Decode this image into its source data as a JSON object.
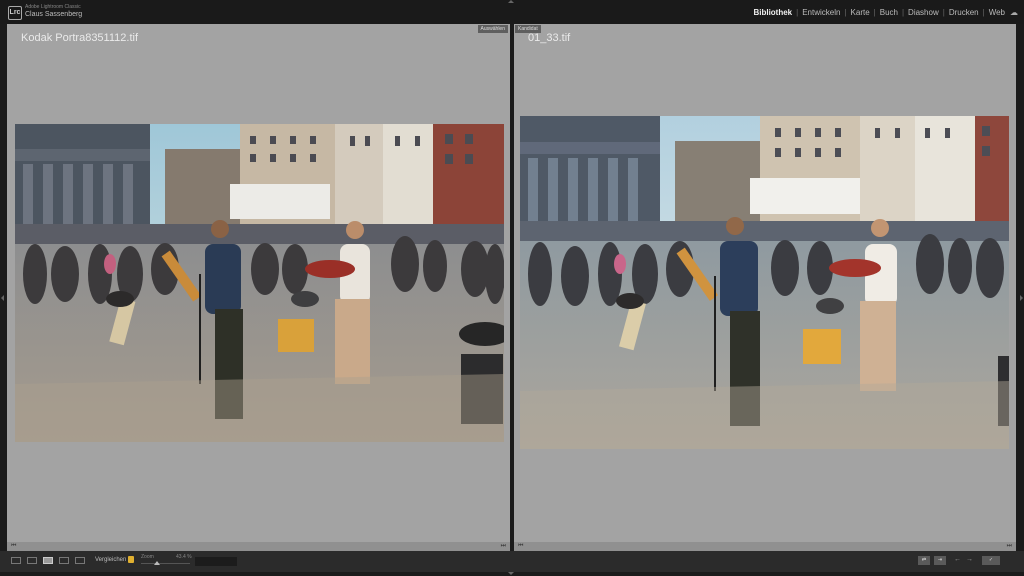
{
  "app": {
    "name": "Adobe Lightroom Classic",
    "user": "Claus Sassenberg",
    "logo_text": "Lrc"
  },
  "modules": [
    {
      "label": "Bibliothek",
      "active": true
    },
    {
      "label": "Entwickeln",
      "active": false
    },
    {
      "label": "Karte",
      "active": false
    },
    {
      "label": "Buch",
      "active": false
    },
    {
      "label": "Diashow",
      "active": false
    },
    {
      "label": "Drucken",
      "active": false
    },
    {
      "label": "Web",
      "active": false
    }
  ],
  "compare": {
    "select": {
      "filename": "Kodak Portra8351112.tif",
      "tag": "Auswählen"
    },
    "candidate": {
      "filename": "01_33.tif",
      "tag": "Kandidat"
    }
  },
  "toolbar": {
    "compare_label": "Vergleichen",
    "zoom_label": "Zoom",
    "zoom_value": "43.4 %",
    "view_modes": [
      "grid-icon",
      "loupe-icon",
      "compare-icon",
      "survey-icon",
      "people-icon"
    ]
  },
  "colors": {
    "accent_lock": "#e0b030",
    "panel_bg": "#a3a3a3",
    "chrome": "#1b1b1b"
  }
}
